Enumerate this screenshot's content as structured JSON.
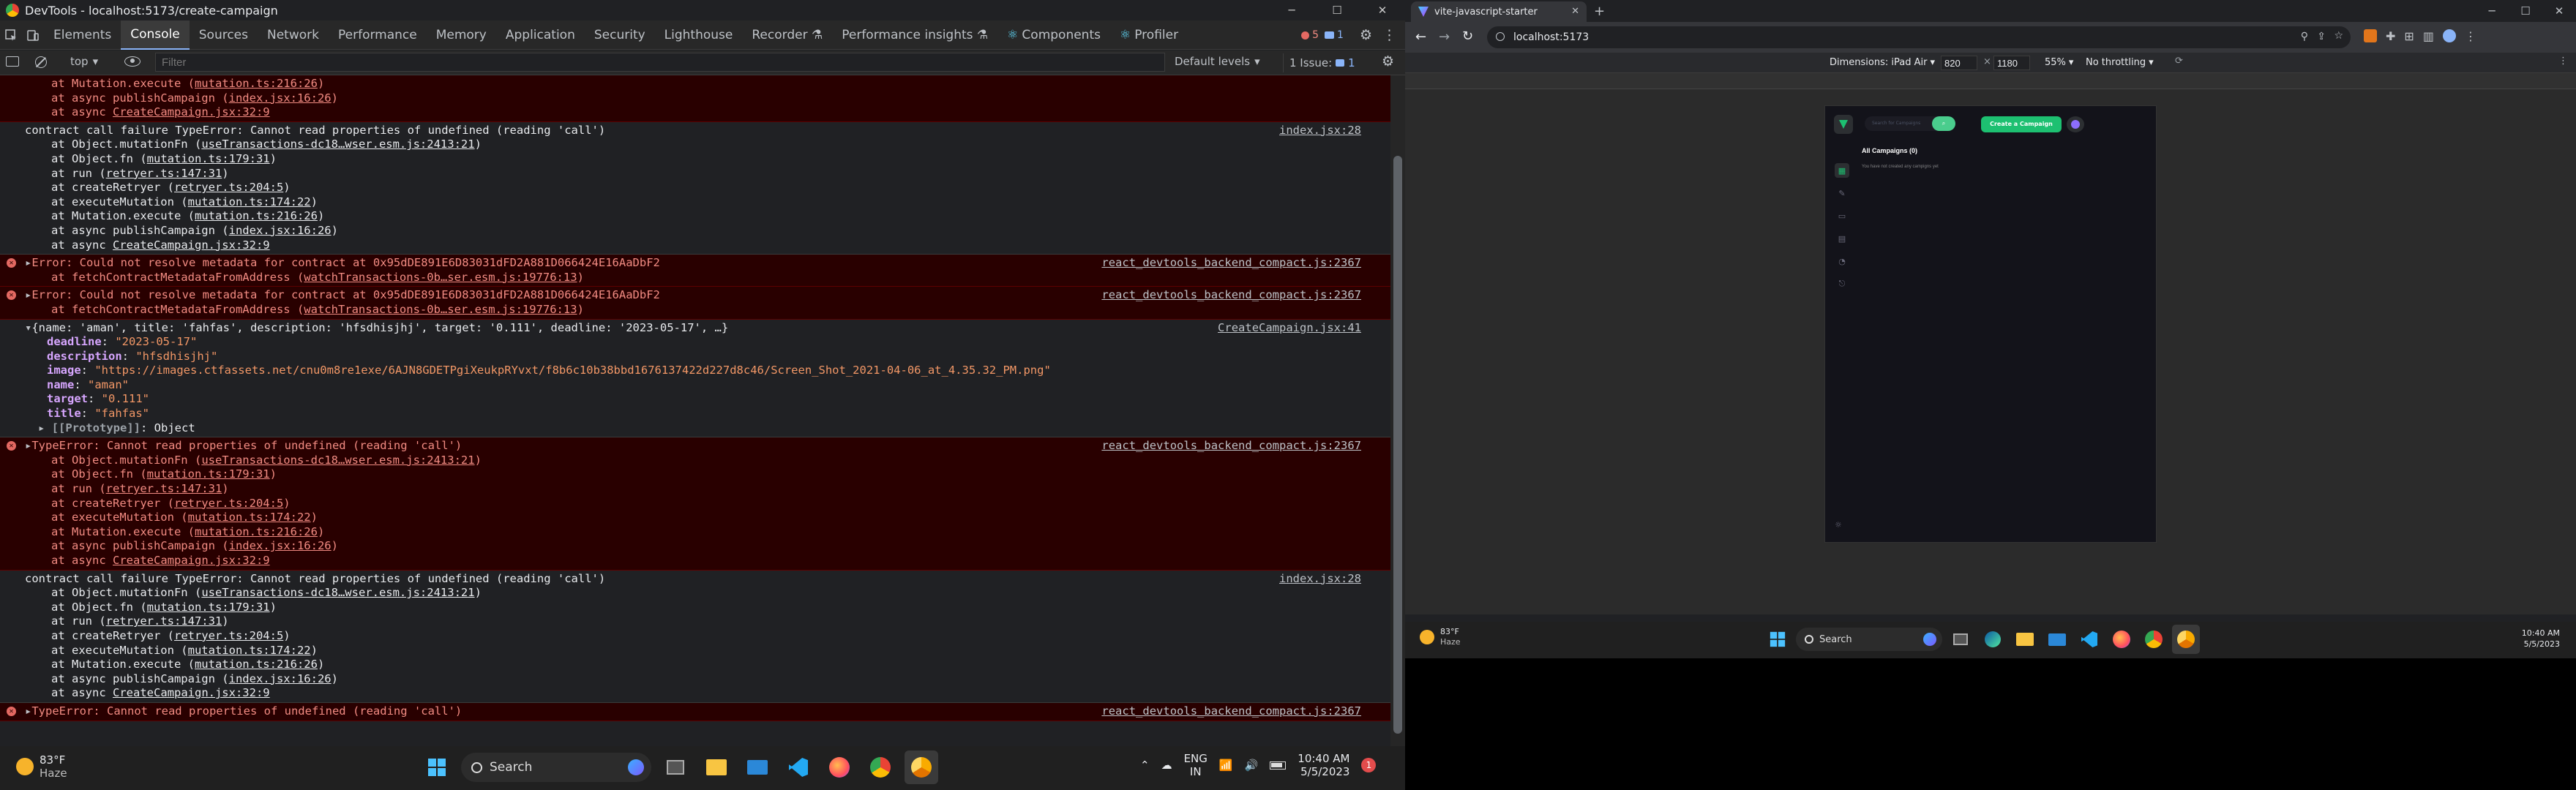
{
  "devtools": {
    "window_title": "DevTools - localhost:5173/create-campaign",
    "window_controls": [
      "─",
      "☐",
      "✕"
    ],
    "tabs": [
      "Elements",
      "Console",
      "Sources",
      "Network",
      "Performance",
      "Memory",
      "Application",
      "Security",
      "Lighthouse",
      "Recorder",
      "Performance insights",
      "Components",
      "Profiler"
    ],
    "active_tab": "Console",
    "badges": {
      "errors": "5",
      "issues": "1"
    },
    "console_toolbar": {
      "context": "top",
      "filter_placeholder": "Filter",
      "levels": "Default levels",
      "issues": "1 Issue:",
      "issues_count": "1"
    },
    "messages": [
      {
        "type": "error",
        "lines": [
          {
            "t": "at ",
            "call": "Mutation.execute",
            "loc": "mutation.ts:216:26"
          },
          {
            "t": "at async ",
            "call": "publishCampaign",
            "loc": "index.jsx:16:26"
          },
          {
            "t": "at async ",
            "call": "CreateCampaign.jsx:32:9",
            "loc": ""
          }
        ]
      },
      {
        "type": "log",
        "source": "index.jsx:28",
        "head": "contract call failure TypeError: Cannot read properties of undefined (reading 'call')",
        "lines": [
          "at Object.mutationFn (useTransactions-dc18…wser.esm.js:2413:21)",
          "at Object.fn (mutation.ts:179:31)",
          "at run (retryer.ts:147:31)",
          "at createRetryer (retryer.ts:204:5)",
          "at executeMutation (mutation.ts:174:22)",
          "at Mutation.execute (mutation.ts:216:26)",
          "at async publishCampaign (index.jsx:16:26)",
          "at async CreateCampaign.jsx:32:9"
        ]
      },
      {
        "type": "error",
        "source": "react_devtools_backend_compact.js:2367",
        "head": "Error: Could not resolve metadata for contract at 0x95dDE891E6D83031dFD2A881D066424E16AaDbF2",
        "lines": [
          "at fetchContractMetadataFromAddress (watchTransactions-0b…ser.esm.js:19776:13)"
        ]
      },
      {
        "type": "error",
        "source": "react_devtools_backend_compact.js:2367",
        "head": "Error: Could not resolve metadata for contract at 0x95dDE891E6D83031dFD2A881D066424E16AaDbF2",
        "lines": [
          "at fetchContractMetadataFromAddress (watchTransactions-0b…ser.esm.js:19776:13)"
        ]
      },
      {
        "type": "object",
        "source": "CreateCampaign.jsx:41",
        "head": "{name: 'aman', title: 'fahfas', description: 'hfsdhisjhj', target: '0.111', deadline: '2023-05-17', …}",
        "props": [
          {
            "k": "deadline",
            "v": "\"2023-05-17\""
          },
          {
            "k": "description",
            "v": "\"hfsdhisjhj\""
          },
          {
            "k": "image",
            "v": "\"https://images.ctfassets.net/cnu0m8re1exe/6AJN8GDETPgiXeukpRYvxt/f8b6c10b38bbd1676137422d227d8c46/Screen_Shot_2021-04-06_at_4.35.32_PM.png\""
          },
          {
            "k": "name",
            "v": "\"aman\""
          },
          {
            "k": "target",
            "v": "\"0.111\""
          },
          {
            "k": "title",
            "v": "\"fahfas\""
          },
          {
            "k": "[[Prototype]]",
            "v": "Object"
          }
        ]
      },
      {
        "type": "error",
        "source": "react_devtools_backend_compact.js:2367",
        "head": "TypeError: Cannot read properties of undefined (reading 'call')",
        "lines": [
          "at Object.mutationFn (useTransactions-dc18…wser.esm.js:2413:21)",
          "at Object.fn (mutation.ts:179:31)",
          "at run (retryer.ts:147:31)",
          "at createRetryer (retryer.ts:204:5)",
          "at executeMutation (mutation.ts:174:22)",
          "at Mutation.execute (mutation.ts:216:26)",
          "at async publishCampaign (index.jsx:16:26)",
          "at async CreateCampaign.jsx:32:9"
        ]
      },
      {
        "type": "log",
        "source": "index.jsx:28",
        "head": "contract call failure TypeError: Cannot read properties of undefined (reading 'call')",
        "lines": [
          "at Object.mutationFn (useTransactions-dc18…wser.esm.js:2413:21)",
          "at Object.fn (mutation.ts:179:31)",
          "at run (retryer.ts:147:31)",
          "at createRetryer (retryer.ts:204:5)",
          "at executeMutation (mutation.ts:174:22)",
          "at Mutation.execute (mutation.ts:216:26)",
          "at async publishCampaign (index.jsx:16:26)",
          "at async CreateCampaign.jsx:32:9"
        ]
      },
      {
        "type": "error",
        "source": "react_devtools_backend_compact.js:2367",
        "head": "TypeError: Cannot read properties of undefined (reading 'call')",
        "lines": []
      }
    ]
  },
  "taskbar_left": {
    "weather_temp": "83°F",
    "weather_desc": "Haze",
    "search": "Search",
    "lang": "ENG",
    "region": "IN",
    "time": "10:40 AM",
    "date": "5/5/2023",
    "notif": "1"
  },
  "browser": {
    "tab_title": "vite-javascript-starter",
    "url": "localhost:5173",
    "device": {
      "label": "Dimensions: iPad Air",
      "width": "820",
      "height": "1180",
      "zoom": "55%",
      "throttle": "No throttling"
    },
    "app": {
      "search_placeholder": "Search for Campaigns",
      "create_button": "Create a Campaign",
      "heading": "All Campaigns (0)",
      "empty": "You have not created any campigns yet"
    }
  },
  "taskbar_right": {
    "weather_temp": "83°F",
    "weather_desc": "Haze",
    "search": "Search",
    "time": "10:40 AM",
    "date": "5/5/2023"
  },
  "colors": {
    "accent": "#8ab4f8",
    "error_bg": "#290000",
    "error_text": "#f28b82",
    "brand_green": "#1dc071",
    "avatar": "#8c6dfd"
  }
}
